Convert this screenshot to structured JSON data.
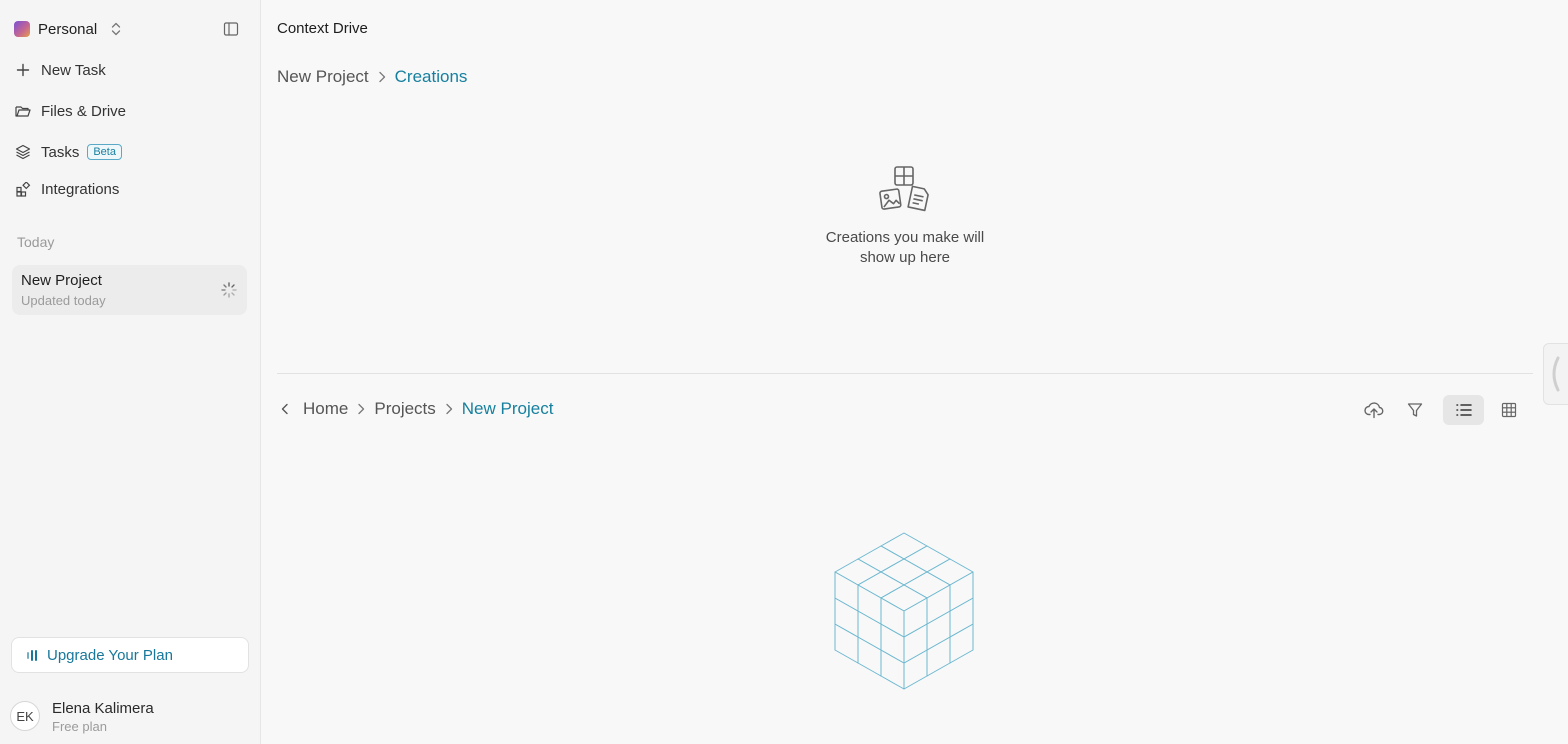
{
  "sidebar": {
    "workspace": {
      "name": "Personal"
    },
    "nav": [
      {
        "label": "New Task",
        "icon": "plus-icon"
      },
      {
        "label": "Files & Drive",
        "icon": "folder-icon"
      },
      {
        "label": "Tasks",
        "icon": "layers-icon",
        "badge": "Beta"
      },
      {
        "label": "Integrations",
        "icon": "integrations-icon"
      }
    ],
    "section_label": "Today",
    "recent": {
      "title": "New Project",
      "subtitle": "Updated today"
    },
    "upgrade_label": "Upgrade Your Plan",
    "user": {
      "initials": "EK",
      "name": "Elena Kalimera",
      "plan": "Free plan"
    }
  },
  "main": {
    "title": "Context Drive",
    "creations": {
      "breadcrumb": [
        "New Project",
        "Creations"
      ],
      "empty_text_line1": "Creations you make will",
      "empty_text_line2": "show up here"
    },
    "files": {
      "breadcrumb": [
        "Home",
        "Projects",
        "New Project"
      ],
      "view_mode": "list"
    }
  },
  "colors": {
    "accent": "#17809f",
    "sidebar_bg": "#f5f5f5",
    "main_bg": "#f8f8f8",
    "cube_stroke": "#6db8d0"
  }
}
